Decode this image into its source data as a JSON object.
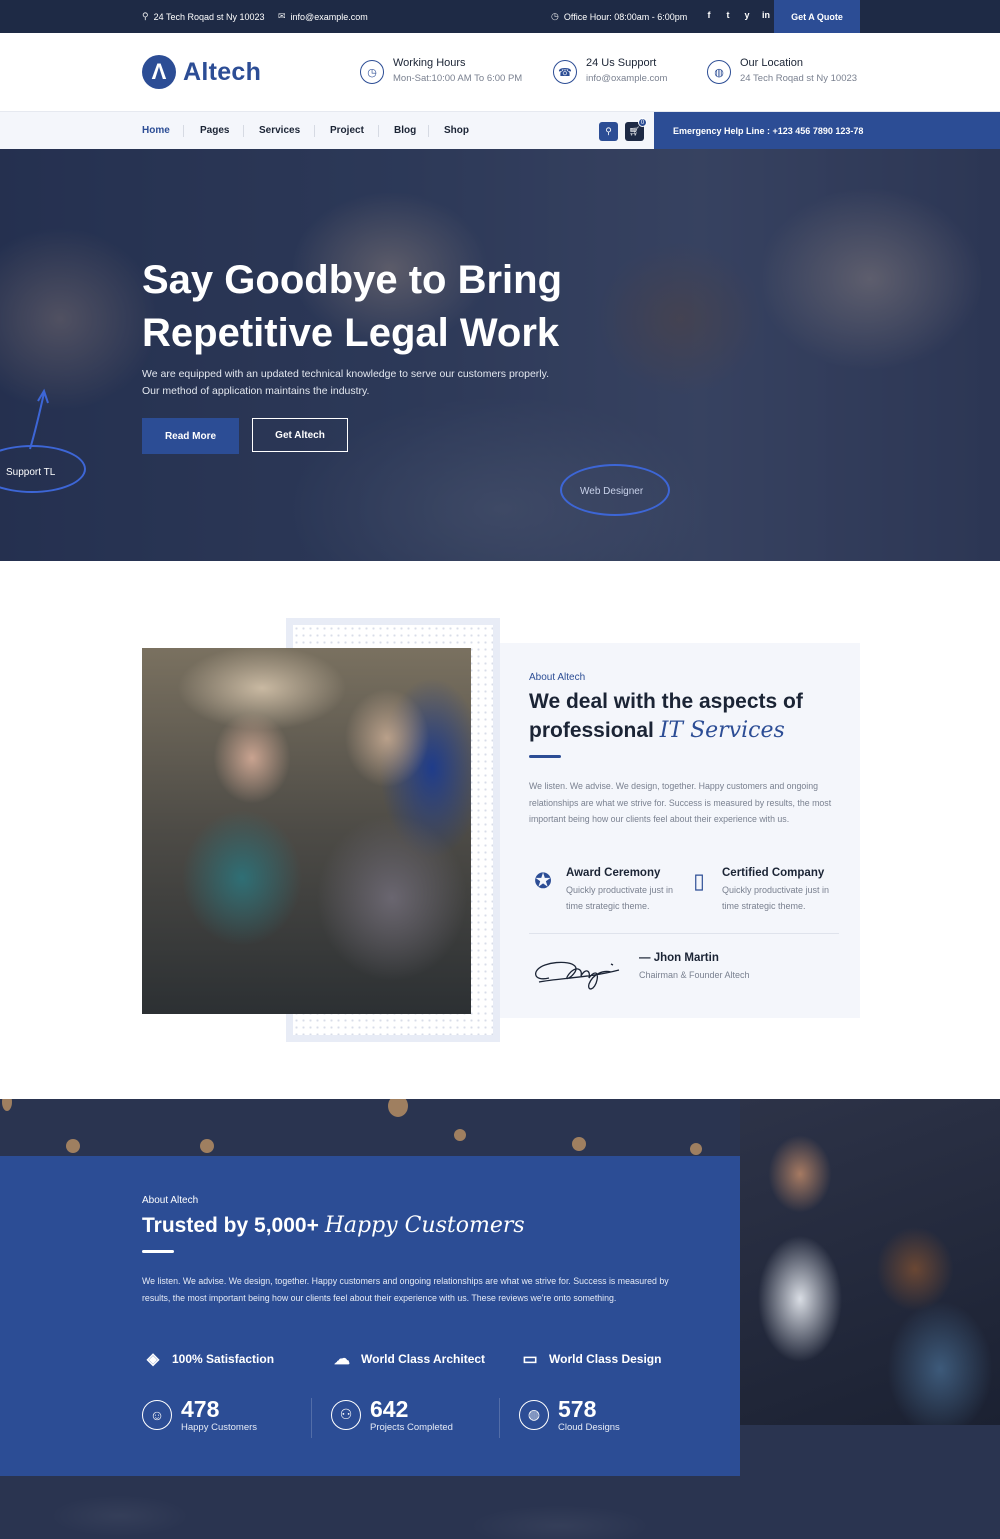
{
  "topbar": {
    "address": "24 Tech Roqad st Ny 10023",
    "email": "info@example.com",
    "office_hours": "Office Hour: 08:00am - 6:00pm",
    "social": [
      "f",
      "t",
      "y",
      "in"
    ],
    "quote_button": "Get A Quote",
    "icons": {
      "address": "pin-icon",
      "email": "mail-icon",
      "clock": "clock-icon"
    }
  },
  "header": {
    "logo_mark": "Λ",
    "logo_text": "Altech",
    "info": [
      {
        "title": "Working Hours",
        "sub": "Mon-Sat:10:00 AM To 6:00 PM",
        "icon": "clock-icon"
      },
      {
        "title": "24 Us Support",
        "sub": "info@oxample.com",
        "icon": "support-icon"
      },
      {
        "title": "Our Location",
        "sub": "24 Tech Roqad st Ny 10023",
        "icon": "globe-icon"
      }
    ]
  },
  "nav": {
    "items": [
      "Home",
      "Pages",
      "Services",
      "Project",
      "Blog",
      "Shop"
    ],
    "active": "Home",
    "cart_count": "0",
    "emergency": "Emergency Help Line : +123 456 7890 123-78",
    "accent": "#2c4d95"
  },
  "hero": {
    "title_line1": "Say Goodbye to Bring",
    "title_line2": "Repetitive Legal Work",
    "description": "We are equipped with an updated technical knowledge to serve our customers properly. Our method of application maintains the industry.",
    "button_primary": "Read More",
    "button_secondary": "Get Altech",
    "tag_left": "Support TL",
    "tag_right": "Web Designer"
  },
  "about": {
    "eyebrow": "About Altech",
    "title_plain": "We deal with the aspects of professional",
    "title_italic": "IT Services",
    "description": "We listen. We advise. We design, together. Happy customers and ongoing relationships are what we strive for. Success is measured by results, the most important being how our clients feel about their experience with us.",
    "features": [
      {
        "title": "Award Ceremony",
        "sub": "Quickly productivate just in time strategic theme.",
        "icon": "award-icon"
      },
      {
        "title": "Certified Company",
        "sub": "Quickly productivate just in time strategic theme.",
        "icon": "bookmark-icon"
      }
    ],
    "founder_name": "— Jhon Martin",
    "founder_role": "Chairman & Founder Altech"
  },
  "stats": {
    "eyebrow": "About Altech",
    "title_plain": "Trusted by 5,000+",
    "title_italic": "Happy Customers",
    "description": "We listen. We advise. We design, together. Happy customers and ongoing relationships are what we strive for. Success is measured by results, the most important being how our clients feel about their experience with us. These reviews we're onto something.",
    "features": [
      {
        "label": "100% Satisfaction",
        "icon": "satisfaction-icon"
      },
      {
        "label": "World Class Architect",
        "icon": "architect-icon"
      },
      {
        "label": "World Class Design",
        "icon": "design-icon"
      }
    ],
    "counters": [
      {
        "number": "478",
        "label": "Happy Customers",
        "icon": "customer-icon"
      },
      {
        "number": "642",
        "label": "Projects Completed",
        "icon": "projects-icon"
      },
      {
        "number": "578",
        "label": "Cloud Designs",
        "icon": "cloud-globe-icon"
      }
    ]
  }
}
